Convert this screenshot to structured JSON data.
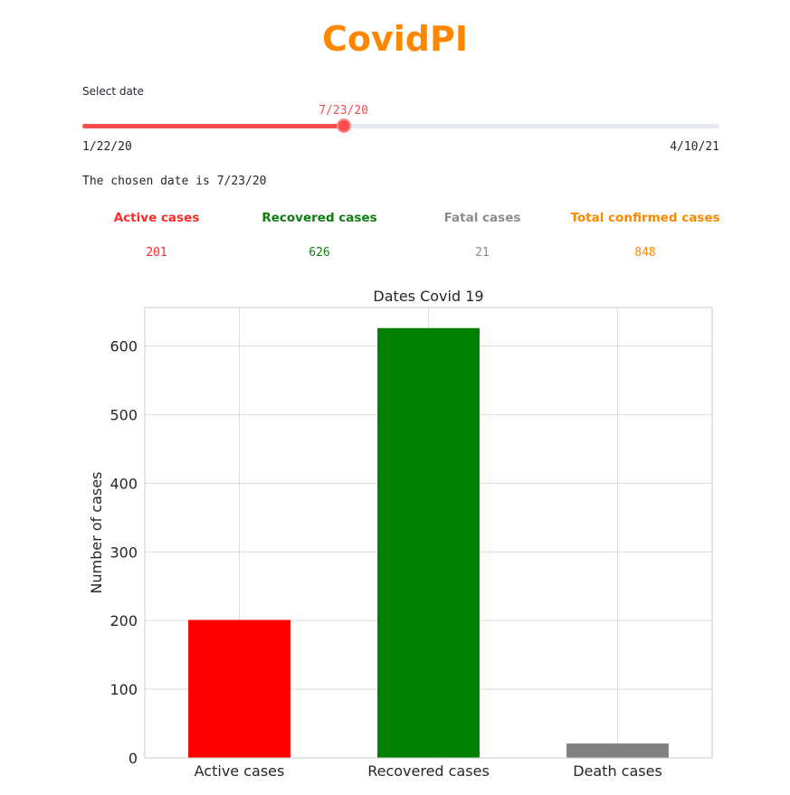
{
  "app": {
    "title": "CovidPI"
  },
  "slider": {
    "label": "Select date",
    "value": "7/23/20",
    "min": "1/22/20",
    "max": "4/10/21",
    "progress_fraction": 0.41
  },
  "chosen_date_text": "The chosen date is 7/23/20",
  "metrics": [
    {
      "label": "Active cases",
      "value": "201",
      "color": "#ff2b2b"
    },
    {
      "label": "Recovered cases",
      "value": "626",
      "color": "#0e7d0e"
    },
    {
      "label": "Fatal cases",
      "value": "21",
      "color": "#8c8c8c"
    },
    {
      "label": "Total confirmed cases",
      "value": "848",
      "color": "#ff8700"
    }
  ],
  "colors": {
    "title": "#ff8700",
    "slider_accent": "#ff4b4b",
    "slider_track": "#e6e9ef",
    "grid": "#dddddd",
    "axes": "#cccccc"
  },
  "chart_data": {
    "type": "bar",
    "title": "Dates Covid 19",
    "xlabel": "",
    "ylabel": "Number of cases",
    "categories": [
      "Active cases",
      "Recovered cases",
      "Death cases"
    ],
    "values": [
      201,
      626,
      21
    ],
    "colors": [
      "#ff0000",
      "#008000",
      "#808080"
    ],
    "ylim": [
      0,
      656
    ],
    "yticks": [
      0,
      100,
      200,
      300,
      400,
      500,
      600
    ],
    "grid": true,
    "legend": "none"
  }
}
